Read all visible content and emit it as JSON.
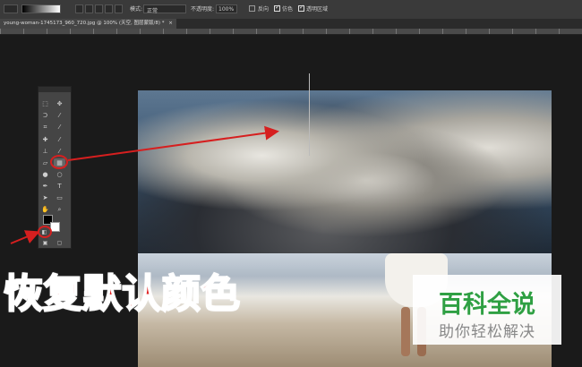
{
  "options_bar": {
    "mode_label": "模式:",
    "mode_value": "正常",
    "opacity_label": "不透明度:",
    "opacity_value": "100%",
    "reverse_label": "反向",
    "dither_label": "仿色",
    "transparency_label": "透明区域"
  },
  "document_tab": {
    "title": "young-woman-1745173_960_720.jpg @ 100% (天空, 图层蒙版/8) *",
    "close": "×"
  },
  "toolbox": {
    "icons": [
      "marquee-icon",
      "move-icon",
      "lasso-icon",
      "magic-wand-icon",
      "crop-icon",
      "eyedropper-icon",
      "healing-icon",
      "brush-icon",
      "stamp-icon",
      "history-brush-icon",
      "eraser-icon",
      "gradient-icon",
      "blur-icon",
      "dodge-icon",
      "pen-icon",
      "text-icon",
      "path-select-icon",
      "shape-icon",
      "hand-icon",
      "zoom-icon"
    ],
    "foreground_color": "#000000",
    "background_color": "#ffffff"
  },
  "annotation": {
    "caption": "恢复默认颜色",
    "arrow_color": "#d61f1f"
  },
  "watermark": {
    "title": "百科全说",
    "subtitle": "助你轻松解决",
    "title_color": "#2fa043"
  }
}
